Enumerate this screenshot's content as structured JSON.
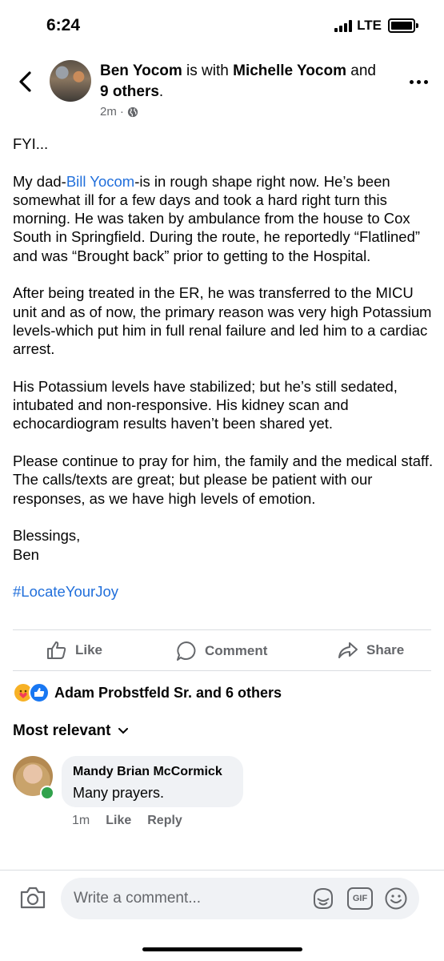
{
  "status_bar": {
    "time": "6:24",
    "network": "LTE"
  },
  "post": {
    "author": "Ben Yocom",
    "with_text": " is with ",
    "tagged": "Michelle Yocom",
    "and_text": " and ",
    "others": "9 others",
    "period": ".",
    "time": "2m",
    "dot": "·",
    "intro": "FYI...",
    "p1_pre": "My dad-",
    "p1_link": "Bill Yocom",
    "p1_post": "-is in rough shape right now. He’s been somewhat ill for a few days and took a hard right turn this morning. He was taken by ambulance from the house to Cox South in Springfield. During the route, he reportedly “Flatlined” and was “Brought back” prior to getting to the Hospital.",
    "p2": "After being treated in the ER, he was transferred to the MICU unit and as of now, the primary reason was very high Potassium levels-which put him in full renal failure and led him to a cardiac arrest.",
    "p3": "His Potassium levels have stabilized; but he’s still sedated, intubated and non-responsive. His kidney scan and echocardiogram results haven’t been shared yet.",
    "p4": "Please continue to pray for him, the family and the medical staff. The calls/texts are great; but please be patient with our responses, as we have high levels of emotion.",
    "signoff1": "Blessings,",
    "signoff2": "Ben",
    "hashtag": "#LocateYourJoy"
  },
  "actions": {
    "like": "Like",
    "comment": "Comment",
    "share": "Share"
  },
  "reactions": {
    "summary": "Adam Probstfeld Sr. and 6 others"
  },
  "comments_filter": "Most relevant",
  "comment": {
    "author": "Mandy Brian McCormick",
    "text": "Many prayers.",
    "time": "1m",
    "like": "Like",
    "reply": "Reply"
  },
  "composer": {
    "placeholder": "Write a comment...",
    "gif": "GIF"
  },
  "colors": {
    "link": "#216fdb",
    "online": "#31a24c",
    "like_blue": "#1877f2"
  }
}
